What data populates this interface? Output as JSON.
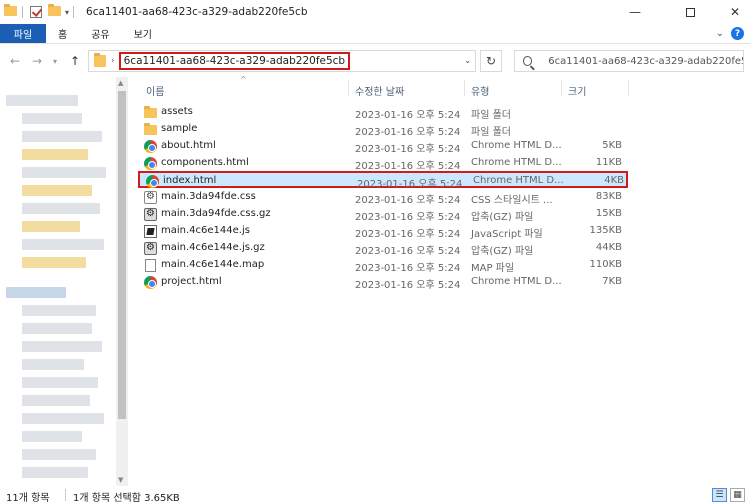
{
  "window": {
    "title": "6ca11401-aa68-423c-a329-adab220fe5cb",
    "minimize": "—",
    "close": "✕"
  },
  "ribbon": {
    "tabs": [
      "파일",
      "홈",
      "공유",
      "보기"
    ],
    "help": "?"
  },
  "address": {
    "path": "6ca11401-aa68-423c-a329-adab220fe5cb",
    "search_placeholder": "6ca11401-aa68-423c-a329-adab220fe5c..."
  },
  "columns": {
    "name": "이름",
    "modified": "수정한 날짜",
    "type": "유형",
    "size": "크기"
  },
  "files": [
    {
      "name": "assets",
      "modified": "2023-01-16 오후 5:24",
      "type": "파일 폴더",
      "size": "",
      "icon": "folder"
    },
    {
      "name": "sample",
      "modified": "2023-01-16 오후 5:24",
      "type": "파일 폴더",
      "size": "",
      "icon": "folder"
    },
    {
      "name": "about.html",
      "modified": "2023-01-16 오후 5:24",
      "type": "Chrome HTML D...",
      "size": "5KB",
      "icon": "chrome"
    },
    {
      "name": "components.html",
      "modified": "2023-01-16 오후 5:24",
      "type": "Chrome HTML D...",
      "size": "11KB",
      "icon": "chrome"
    },
    {
      "name": "index.html",
      "modified": "2023-01-16 오후 5:24",
      "type": "Chrome HTML D...",
      "size": "4KB",
      "icon": "chrome",
      "selected": true
    },
    {
      "name": "main.3da94fde.css",
      "modified": "2023-01-16 오후 5:24",
      "type": "CSS 스타일시트 ...",
      "size": "83KB",
      "icon": "gear"
    },
    {
      "name": "main.3da94fde.css.gz",
      "modified": "2023-01-16 오후 5:24",
      "type": "압축(GZ) 파일",
      "size": "15KB",
      "icon": "zip"
    },
    {
      "name": "main.4c6e144e.js",
      "modified": "2023-01-16 오후 5:24",
      "type": "JavaScript 파일",
      "size": "135KB",
      "icon": "js"
    },
    {
      "name": "main.4c6e144e.js.gz",
      "modified": "2023-01-16 오후 5:24",
      "type": "압축(GZ) 파일",
      "size": "44KB",
      "icon": "zip"
    },
    {
      "name": "main.4c6e144e.map",
      "modified": "2023-01-16 오후 5:24",
      "type": "MAP 파일",
      "size": "110KB",
      "icon": "doc"
    },
    {
      "name": "project.html",
      "modified": "2023-01-16 오후 5:24",
      "type": "Chrome HTML D...",
      "size": "7KB",
      "icon": "chrome"
    }
  ],
  "status": {
    "count": "11개 항목",
    "selection": "1개 항목 선택함 3.65KB"
  },
  "colors": {
    "selection_outline": "#d31a1a",
    "selection_fill": "#cce8ff",
    "file_tab": "#1a5fb4",
    "folder": "#f6c45a"
  }
}
